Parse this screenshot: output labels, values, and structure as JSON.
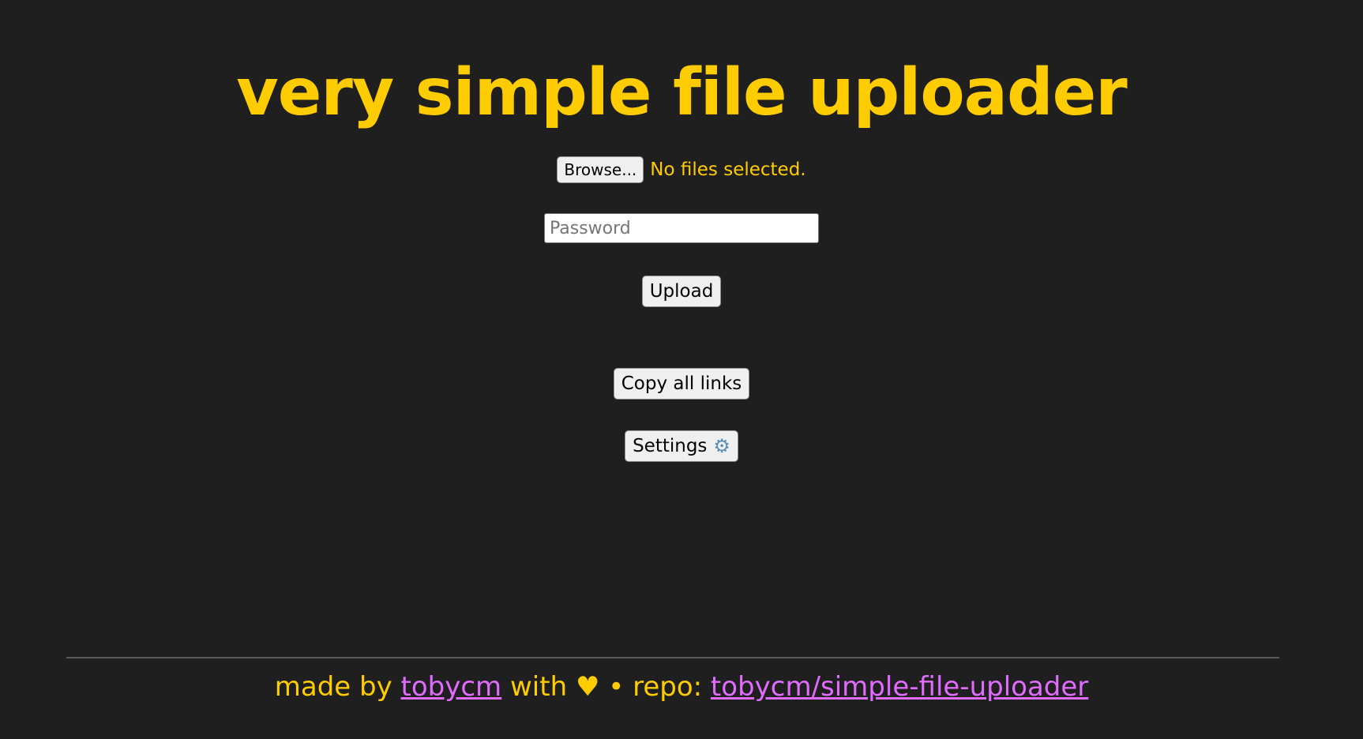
{
  "header": {
    "title": "very simple file uploader"
  },
  "upload_form": {
    "browse_label": "Browse...",
    "file_status": "No files selected.",
    "password_placeholder": "Password",
    "password_value": "",
    "upload_label": "Upload"
  },
  "actions": {
    "copy_all_label": "Copy all links",
    "settings_label": "Settings",
    "settings_icon": "gear-icon"
  },
  "footer": {
    "made_by_text": "made by",
    "author_link": "tobycm",
    "with_text": "with",
    "heart": "♥",
    "separator": "•",
    "repo_text": "repo:",
    "repo_link": "tobycm/simple-file-uploader"
  },
  "colors": {
    "background": "#1f1f1f",
    "accent": "#ffcc00",
    "link": "#e26bff",
    "button_bg": "#efefef"
  }
}
